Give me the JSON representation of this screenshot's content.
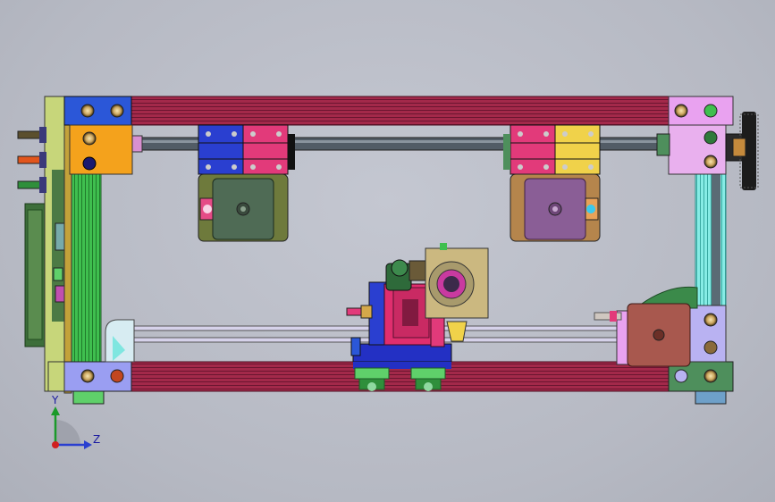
{
  "triad": {
    "y_label": "Y",
    "z_label": "Z"
  },
  "colors": {
    "background": "#b9bcc6",
    "frame_rail": "#a8294a",
    "lead_screw": "#4a5560",
    "motor_green": "#4f6b55",
    "motor_purple": "#8a5e96",
    "motor_red": "#a8584e",
    "block_blue": "#2a3fd0",
    "block_pink": "#e23a7a",
    "block_yellow": "#f0d24a",
    "corner_orange": "#f4a21c",
    "corner_violet": "#e9b0ee",
    "corner_green": "#4e8f5c",
    "rail_green": "#39b54a",
    "rail_cyan": "#7fe6e0"
  }
}
